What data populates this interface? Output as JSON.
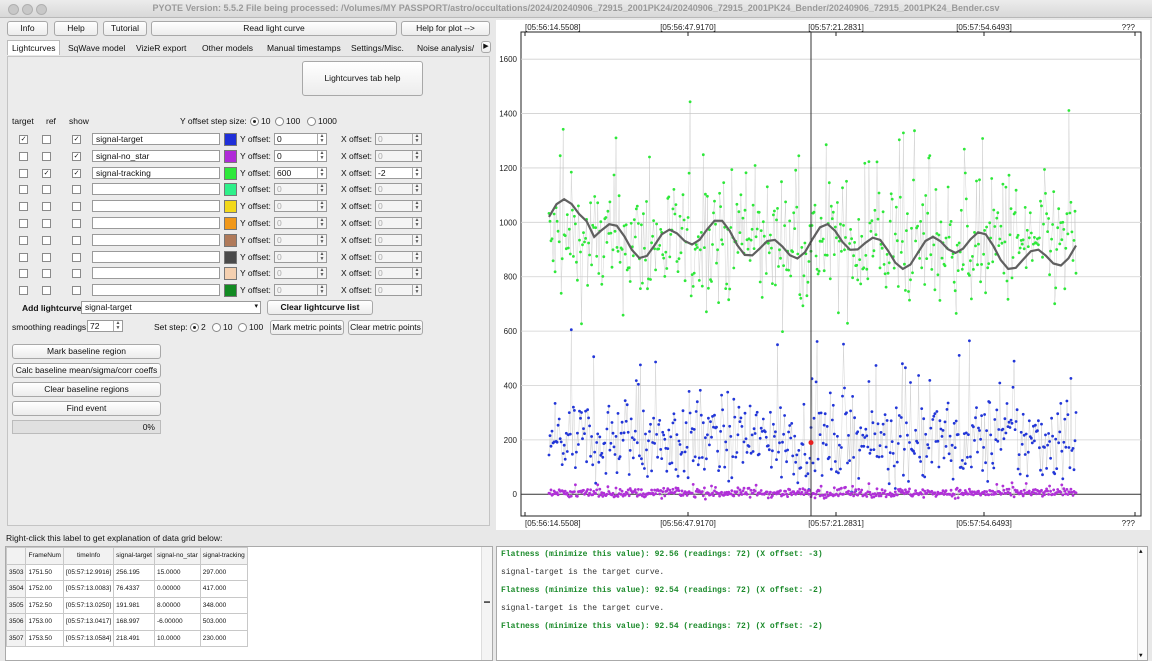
{
  "window": {
    "title": "PYOTE Version: 5.5.2  File being processed: /Volumes/MY PASSPORT/astro/occultations/2024/20240906_72915_2001PK24/20240906_72915_2001PK24_Bender/20240906_72915_2001PK24_Bender.csv"
  },
  "toolbar": {
    "info": "Info",
    "help": "Help",
    "tutorial": "Tutorial",
    "read_light_curve": "Read light curve",
    "help_for_plot": "Help for plot -->"
  },
  "tabs": [
    "Lightcurves",
    "SqWave model",
    "VizieR export",
    "Other models",
    "Manual timestamps",
    "Settings/Misc.",
    "Noise analysis/"
  ],
  "panel": {
    "help_button": "Lightcurves tab help",
    "col_target": "target",
    "col_ref": "ref",
    "col_show": "show",
    "yoffset_step_label": "Y offset step size:",
    "yoffset_steps": [
      "10",
      "100",
      "1000"
    ],
    "y_offset_label": "Y offset:",
    "x_offset_label": "X offset:",
    "rows": [
      {
        "target": true,
        "ref": false,
        "show": true,
        "name": "signal-target",
        "color": "#1f2fd8",
        "yoff": "0",
        "xoff": "0",
        "enabled": true,
        "xenabled": false
      },
      {
        "target": false,
        "ref": false,
        "show": true,
        "name": "signal-no_star",
        "color": "#b02ad8",
        "yoff": "0",
        "xoff": "0",
        "enabled": true,
        "xenabled": false
      },
      {
        "target": false,
        "ref": true,
        "show": true,
        "name": "signal-tracking",
        "color": "#2ee83a",
        "yoff": "600",
        "xoff": "-2",
        "enabled": true,
        "xenabled": true
      },
      {
        "target": false,
        "ref": false,
        "show": false,
        "name": "",
        "color": "#2ef08a",
        "yoff": "0",
        "xoff": "0",
        "enabled": false,
        "xenabled": false
      },
      {
        "target": false,
        "ref": false,
        "show": false,
        "name": "",
        "color": "#f2d81a",
        "yoff": "0",
        "xoff": "0",
        "enabled": false,
        "xenabled": false
      },
      {
        "target": false,
        "ref": false,
        "show": false,
        "name": "",
        "color": "#f0981a",
        "yoff": "0",
        "xoff": "0",
        "enabled": false,
        "xenabled": false
      },
      {
        "target": false,
        "ref": false,
        "show": false,
        "name": "",
        "color": "#b07a5a",
        "yoff": "0",
        "xoff": "0",
        "enabled": false,
        "xenabled": false
      },
      {
        "target": false,
        "ref": false,
        "show": false,
        "name": "",
        "color": "#4a4a4a",
        "yoff": "0",
        "xoff": "0",
        "enabled": false,
        "xenabled": false
      },
      {
        "target": false,
        "ref": false,
        "show": false,
        "name": "",
        "color": "#f4d0b0",
        "yoff": "0",
        "xoff": "0",
        "enabled": false,
        "xenabled": false
      },
      {
        "target": false,
        "ref": false,
        "show": false,
        "name": "",
        "color": "#128a22",
        "yoff": "0",
        "xoff": "0",
        "enabled": false,
        "xenabled": false
      }
    ],
    "add_lightcurve_label": "Add lightcurve",
    "add_lightcurve_value": "signal-target",
    "clear_list": "Clear lightcurve list",
    "smoothing_label": "smoothing readings",
    "smoothing_value": "72",
    "set_step_label": "Set step:",
    "set_steps": [
      "2",
      "10",
      "100"
    ],
    "mark_metric": "Mark metric points",
    "clear_metric": "Clear metric points",
    "mark_baseline": "Mark baseline region",
    "calc_baseline": "Calc baseline mean/sigma/corr coeffs",
    "clear_baseline": "Clear baseline regions",
    "find_event": "Find event",
    "progress_text": "0%",
    "progress": 0
  },
  "grid": {
    "hint": "Right-click this label to get explanation of data grid below:",
    "headers": [
      "",
      "FrameNum",
      "timeInfo",
      "signal-target",
      "signal-no_star",
      "signal-tracking"
    ],
    "rows": [
      [
        "3503",
        "1751.50",
        "[05:57:12.9916]",
        "256.195",
        "15.0000",
        "297.000"
      ],
      [
        "3504",
        "1752.00",
        "[05:57:13.0083]",
        "76.4337",
        "0.00000",
        "417.000"
      ],
      [
        "3505",
        "1752.50",
        "[05:57:13.0250]",
        "191.981",
        "8.00000",
        "348.000"
      ],
      [
        "3506",
        "1753.00",
        "[05:57:13.0417]",
        "168.997",
        "-6.00000",
        "503.000"
      ],
      [
        "3507",
        "1753.50",
        "[05:57:13.0584]",
        "218.491",
        "10.0000",
        "230.000"
      ]
    ]
  },
  "log": [
    {
      "kind": "ok",
      "text": "Flatness (minimize this value): 92.56 (readings: 72) (X offset: -3)"
    },
    {
      "kind": "plain",
      "text": "signal-target is the target curve."
    },
    {
      "kind": "ok",
      "text": "Flatness (minimize this value): 92.54 (readings: 72) (X offset: -2)"
    },
    {
      "kind": "plain",
      "text": "signal-target is the target curve."
    },
    {
      "kind": "ok",
      "text": "Flatness (minimize this value): 92.54 (readings: 72) (X offset: -2)"
    }
  ],
  "chart_data": {
    "type": "scatter",
    "top_axis_labels": [
      "[05:56:14.5508]",
      "[05:56:47.9170]",
      "[05:57:21.2831]",
      "[05:57:54.6493]",
      "???"
    ],
    "bottom_axis_labels": [
      "[05:56:14.5508]",
      "[05:56:47.9170]",
      "[05:57:21.2831]",
      "[05:57:54.6493]",
      "???"
    ],
    "y_ticks": [
      "0",
      "200",
      "400",
      "600",
      "800",
      "1000",
      "1200",
      "1400",
      "1600"
    ],
    "ylim": [
      -80,
      1700
    ],
    "grid": "horizontal",
    "series": [
      {
        "name": "signal-tracking",
        "color": "#2ee83a",
        "mean": 920,
        "spread": 160
      },
      {
        "name": "signal-target",
        "color": "#2236d8",
        "mean": 200,
        "spread": 110
      },
      {
        "name": "signal-no_star",
        "color": "#b030d8",
        "mean": 5,
        "spread": 12
      }
    ],
    "smoothed_series_color": "#606060",
    "cursor_x_fraction": 0.5,
    "highlight_point": {
      "y": 190,
      "color": "#e82020"
    }
  }
}
